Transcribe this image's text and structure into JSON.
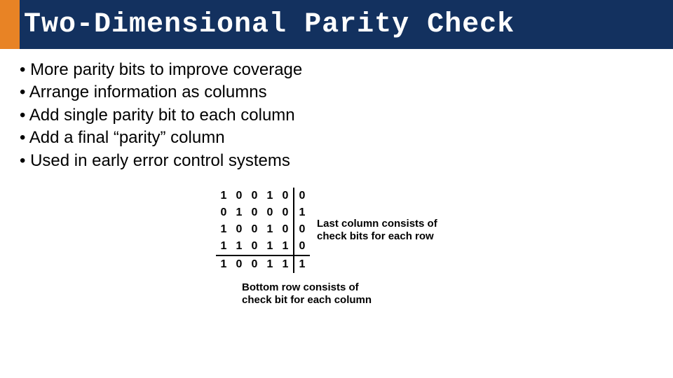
{
  "title": "Two-Dimensional Parity Check",
  "bullets": [
    "More parity bits to improve coverage",
    "Arrange information as columns",
    "Add single parity bit to each column",
    "Add a final “parity” column",
    "Used in early error control systems"
  ],
  "chart_data": {
    "type": "table",
    "title": "Two-Dimensional Parity Check matrix",
    "rows": [
      [
        "1",
        "0",
        "0",
        "1",
        "0",
        "0"
      ],
      [
        "0",
        "1",
        "0",
        "0",
        "0",
        "1"
      ],
      [
        "1",
        "0",
        "0",
        "1",
        "0",
        "0"
      ],
      [
        "1",
        "1",
        "0",
        "1",
        "1",
        "0"
      ],
      [
        "1",
        "0",
        "0",
        "1",
        "1",
        "1"
      ]
    ],
    "last_column_is_parity": true,
    "last_row_is_parity": true
  },
  "side_note": "Last column consists of check bits for each row",
  "bottom_note": "Bottom row consists of check bit for each column"
}
